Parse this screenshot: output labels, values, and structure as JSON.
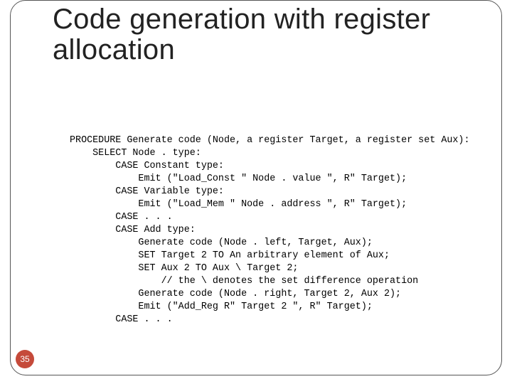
{
  "title": "Code generation with register allocation",
  "page_number": "35",
  "code_lines": [
    "PROCEDURE Generate code (Node, a register Target, a register set Aux):",
    "    SELECT Node . type:",
    "        CASE Constant type:",
    "            Emit (\"Load_Const \" Node . value \", R\" Target);",
    "        CASE Variable type:",
    "            Emit (\"Load_Mem \" Node . address \", R\" Target);",
    "        CASE . . .",
    "        CASE Add type:",
    "            Generate code (Node . left, Target, Aux);",
    "            SET Target 2 TO An arbitrary element of Aux;",
    "            SET Aux 2 TO Aux \\ Target 2;",
    "                // the \\ denotes the set difference operation",
    "            Generate code (Node . right, Target 2, Aux 2);",
    "            Emit (\"Add_Reg R\" Target 2 \", R\" Target);",
    "        CASE . . ."
  ]
}
